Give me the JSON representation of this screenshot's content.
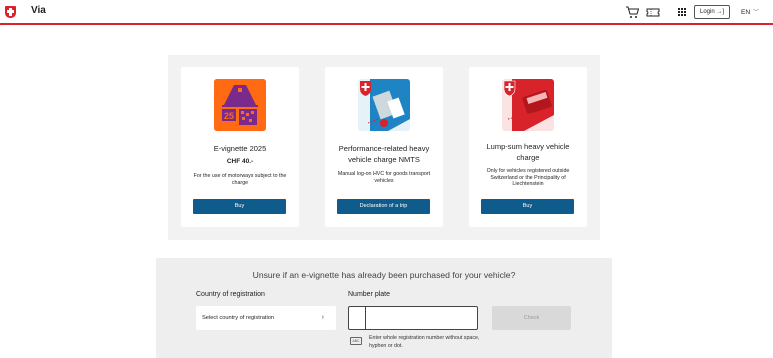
{
  "header": {
    "brand": "Via",
    "login_label": "Login",
    "language": "EN",
    "icons": [
      "swiss-flag-icon",
      "cart-icon",
      "ticket-icon",
      "app-grid-icon",
      "login-icon",
      "chevron-down-icon"
    ]
  },
  "products": [
    {
      "title": "E-vignette 2025",
      "price": "CHF 40.-",
      "description": "For the use of motorways subject to the charge",
      "button_label": "Buy",
      "image_icon": "motorway-vignette-icon",
      "image_color": "#ff6a13"
    },
    {
      "title": "Performance-related heavy vehicle charge NMTS",
      "price": "",
      "description": "Manual log-on HVC for goods transport vehicles",
      "button_label": "Declaration of a trip",
      "image_icon": "truck-icon",
      "image_color": "#1e84c4"
    },
    {
      "title": "Lump-sum heavy vehicle charge",
      "price": "",
      "description": "Only for vehicles registered outside Switzerland or the Principality of Liechtenstein",
      "button_label": "Buy",
      "image_icon": "bus-icon",
      "image_color": "#d8232a"
    }
  ],
  "vignette_check": {
    "title": "Unsure if an e-vignette has already been purchased for your vehicle?",
    "country_label": "Country of registration",
    "country_placeholder": "Select country of registration",
    "plate_label": "Number plate",
    "check_label": "Check",
    "hint_badge": "ABC",
    "hint_text": "Enter whole registration number without space, hyphen or dot."
  },
  "colors": {
    "accent_red": "#d8232a",
    "button_blue": "#0f5c8c",
    "panel_gray": "#f2f2f2"
  }
}
